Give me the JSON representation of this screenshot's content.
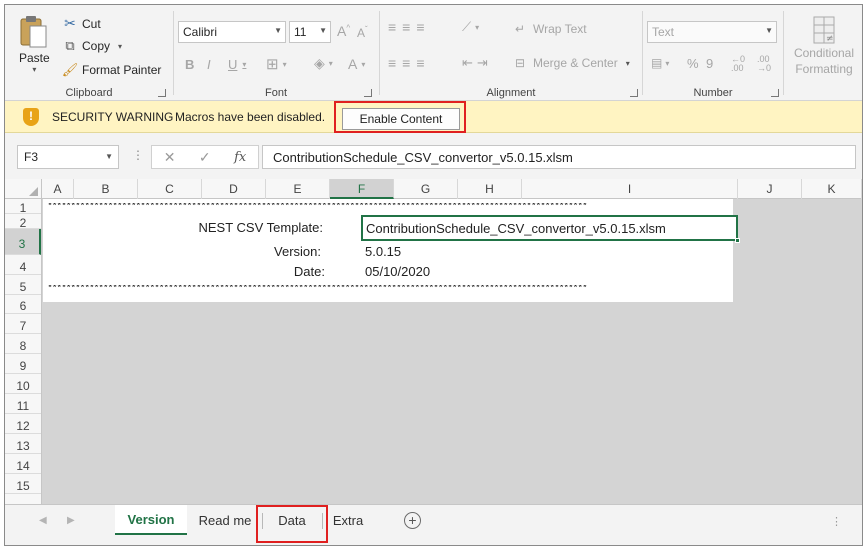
{
  "ribbon": {
    "clipboard": {
      "label": "Clipboard",
      "paste": "Paste",
      "cut": "Cut",
      "copy": "Copy",
      "format_painter": "Format Painter"
    },
    "font": {
      "label": "Font",
      "name": "Calibri",
      "size": "11",
      "bold": "B",
      "italic": "I",
      "underline": "U"
    },
    "alignment": {
      "label": "Alignment",
      "wrap_text": "Wrap Text",
      "merge_center": "Merge & Center"
    },
    "number": {
      "label": "Number",
      "format": "Text",
      "percent": "%",
      "comma": "9"
    },
    "styles": {
      "conditional_formatting": "Conditional Formatting"
    }
  },
  "security": {
    "title": "SECURITY WARNING",
    "message": "Macros have been disabled.",
    "button": "Enable Content"
  },
  "formula_bar": {
    "name_box": "F3",
    "fx": "fx",
    "value": "ContributionSchedule_CSV_convertor_v5.0.15.xlsm"
  },
  "grid": {
    "columns": [
      "A",
      "B",
      "C",
      "D",
      "E",
      "F",
      "G",
      "H",
      "I",
      "J",
      "K"
    ],
    "rows": [
      "1",
      "2",
      "3",
      "4",
      "5",
      "6",
      "7",
      "8",
      "9",
      "10",
      "11",
      "12",
      "13",
      "14",
      "15"
    ],
    "selected_column": "F",
    "selected_row": "3",
    "star_line": "********************************************************************************************************************",
    "labels": {
      "template": "NEST CSV Template:",
      "version": "Version:",
      "date": "Date:"
    },
    "values": {
      "template": "ContributionSchedule_CSV_convertor_v5.0.15.xlsm",
      "version": "5.0.15",
      "date": "05/10/2020"
    }
  },
  "sheet_tabs": [
    {
      "label": "Version",
      "active": true
    },
    {
      "label": "Read me",
      "active": false
    },
    {
      "label": "Data",
      "active": false
    },
    {
      "label": "Extra",
      "active": false
    }
  ],
  "colors": {
    "accent": "#217346",
    "warning_bar": "#fff4c2",
    "highlight": "#e02020"
  }
}
